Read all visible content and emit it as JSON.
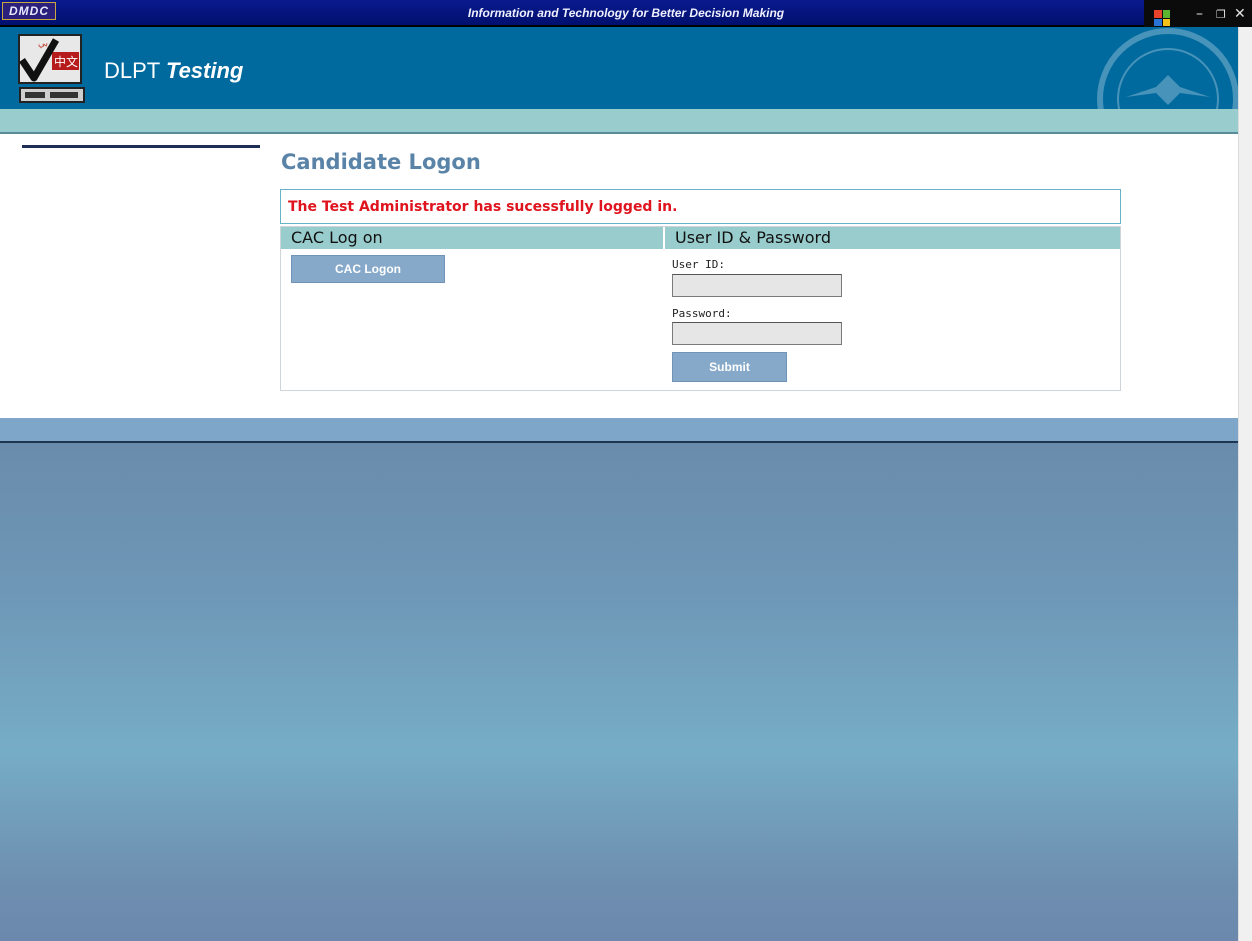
{
  "topbar": {
    "badge": "DMDC",
    "tagline": "Information and Technology for Better Decision Making",
    "controls": {
      "minimize": "–",
      "restore": "🗗",
      "close": "✕"
    }
  },
  "header": {
    "logo_script_arabic": "عربي",
    "logo_script_chinese": "中文",
    "title_main": "DLPT ",
    "title_italic": "Testing",
    "seal_icon": "department-of-defense-seal"
  },
  "page": {
    "title": "Candidate Logon",
    "message": "The Test Administrator has sucessfully logged in."
  },
  "cac": {
    "header": "CAC Log on",
    "button_label": "CAC Logon"
  },
  "credentials": {
    "header": "User ID & Password",
    "user_id_label": "User ID:",
    "user_id_value": "",
    "password_label": "Password:",
    "password_value": "",
    "submit_label": "Submit"
  },
  "colors": {
    "header_blue": "#006a9e",
    "teal_band": "#99cccc",
    "message_red": "#e0141e",
    "title_blue": "#5a83a8"
  }
}
